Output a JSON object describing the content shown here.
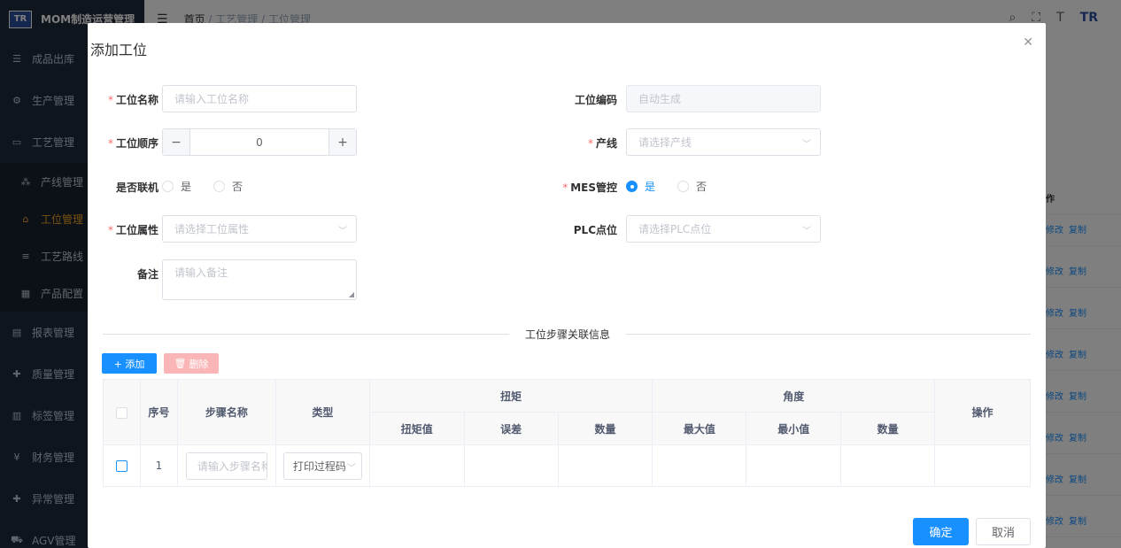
{
  "app": {
    "logo_text": "TR",
    "title": "MOM制造运营管理"
  },
  "breadcrumb": [
    "首页",
    "工艺管理",
    "工位管理"
  ],
  "sidebar": {
    "items": [
      {
        "label": "成品出库",
        "icon": "list-icon"
      },
      {
        "label": "生产管理",
        "icon": "gear-icon"
      },
      {
        "label": "工艺管理",
        "icon": "card-icon"
      },
      {
        "label": "产线管理",
        "icon": "tree-icon",
        "sub": true
      },
      {
        "label": "工位管理",
        "icon": "tag-icon",
        "sub": true,
        "active": true
      },
      {
        "label": "工艺路线",
        "icon": "route-icon",
        "sub": true
      },
      {
        "label": "产品配置",
        "icon": "config-icon",
        "sub": true
      },
      {
        "label": "报表管理",
        "icon": "report-icon"
      },
      {
        "label": "质量管理",
        "icon": "quality-icon"
      },
      {
        "label": "标签管理",
        "icon": "label-icon"
      },
      {
        "label": "财务管理",
        "icon": "yen-icon"
      },
      {
        "label": "异常管理",
        "icon": "alert-icon"
      },
      {
        "label": "AGV管理",
        "icon": "cart-icon"
      }
    ]
  },
  "bg_table": {
    "header": "作",
    "edit": "修改",
    "copy": "复制"
  },
  "dialog": {
    "title": "添加工位",
    "fields": {
      "name": {
        "label": "工位名称",
        "placeholder": "请输入工位名称"
      },
      "code": {
        "label": "工位编码",
        "placeholder": "自动生成"
      },
      "order": {
        "label": "工位顺序",
        "value": "0"
      },
      "line": {
        "label": "产线",
        "placeholder": "请选择产线"
      },
      "online": {
        "label": "是否联机",
        "yes": "是",
        "no": "否"
      },
      "mes": {
        "label": "MES管控",
        "yes": "是",
        "no": "否"
      },
      "attr": {
        "label": "工位属性",
        "placeholder": "请选择工位属性"
      },
      "plc": {
        "label": "PLC点位",
        "placeholder": "请选择PLC点位"
      },
      "remark": {
        "label": "备注",
        "placeholder": "请输入备注"
      }
    },
    "section_title": "工位步骤关联信息",
    "add_btn": "+ 添加",
    "del_btn": "删除",
    "table": {
      "h_index": "序号",
      "h_step": "步骤名称",
      "h_type": "类型",
      "h_torque": "扭矩",
      "h_angle": "角度",
      "h_op": "操作",
      "torque_cols": [
        "扭矩值",
        "误差",
        "数量"
      ],
      "angle_cols": [
        "最大值",
        "最小值",
        "数量"
      ],
      "rows": [
        {
          "index": "1",
          "step_placeholder": "请输入步骤名称",
          "type": "打印过程码"
        }
      ]
    },
    "ok_btn": "确定",
    "cancel_btn": "取消"
  },
  "colors": {
    "primary": "#1890ff",
    "danger_light": "#fab6b6",
    "sidebar_bg": "#1e2b3a",
    "active_menu": "#f5a623"
  }
}
